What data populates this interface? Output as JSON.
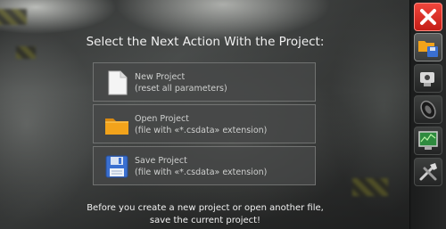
{
  "dialog": {
    "title": "Select the Next Action With the Project:",
    "items": [
      {
        "label": "New Project",
        "description": "(reset all parameters)",
        "icon": "blank-document-icon"
      },
      {
        "label": "Open Project",
        "description": "(file with «*.csdata» extension)",
        "icon": "folder-icon"
      },
      {
        "label": "Save Project",
        "description": "(file with «*.csdata» extension)",
        "icon": "floppy-disk-icon"
      }
    ],
    "footer_line1": "Before you create a new project or open another file,",
    "footer_line2": "save the current project!"
  },
  "toolbar": {
    "buttons": [
      {
        "icon": "close-icon",
        "color": "#e02a22"
      },
      {
        "icon": "folder-save-icon",
        "active": true
      },
      {
        "icon": "camera-icon"
      },
      {
        "icon": "tire-icon"
      },
      {
        "icon": "monitor-chart-icon",
        "color": "#2e8b3e"
      },
      {
        "icon": "tools-icon"
      }
    ]
  },
  "colors": {
    "accent_close": "#e02a22",
    "folder": "#f2a31b",
    "floppy": "#3a6fd0"
  }
}
